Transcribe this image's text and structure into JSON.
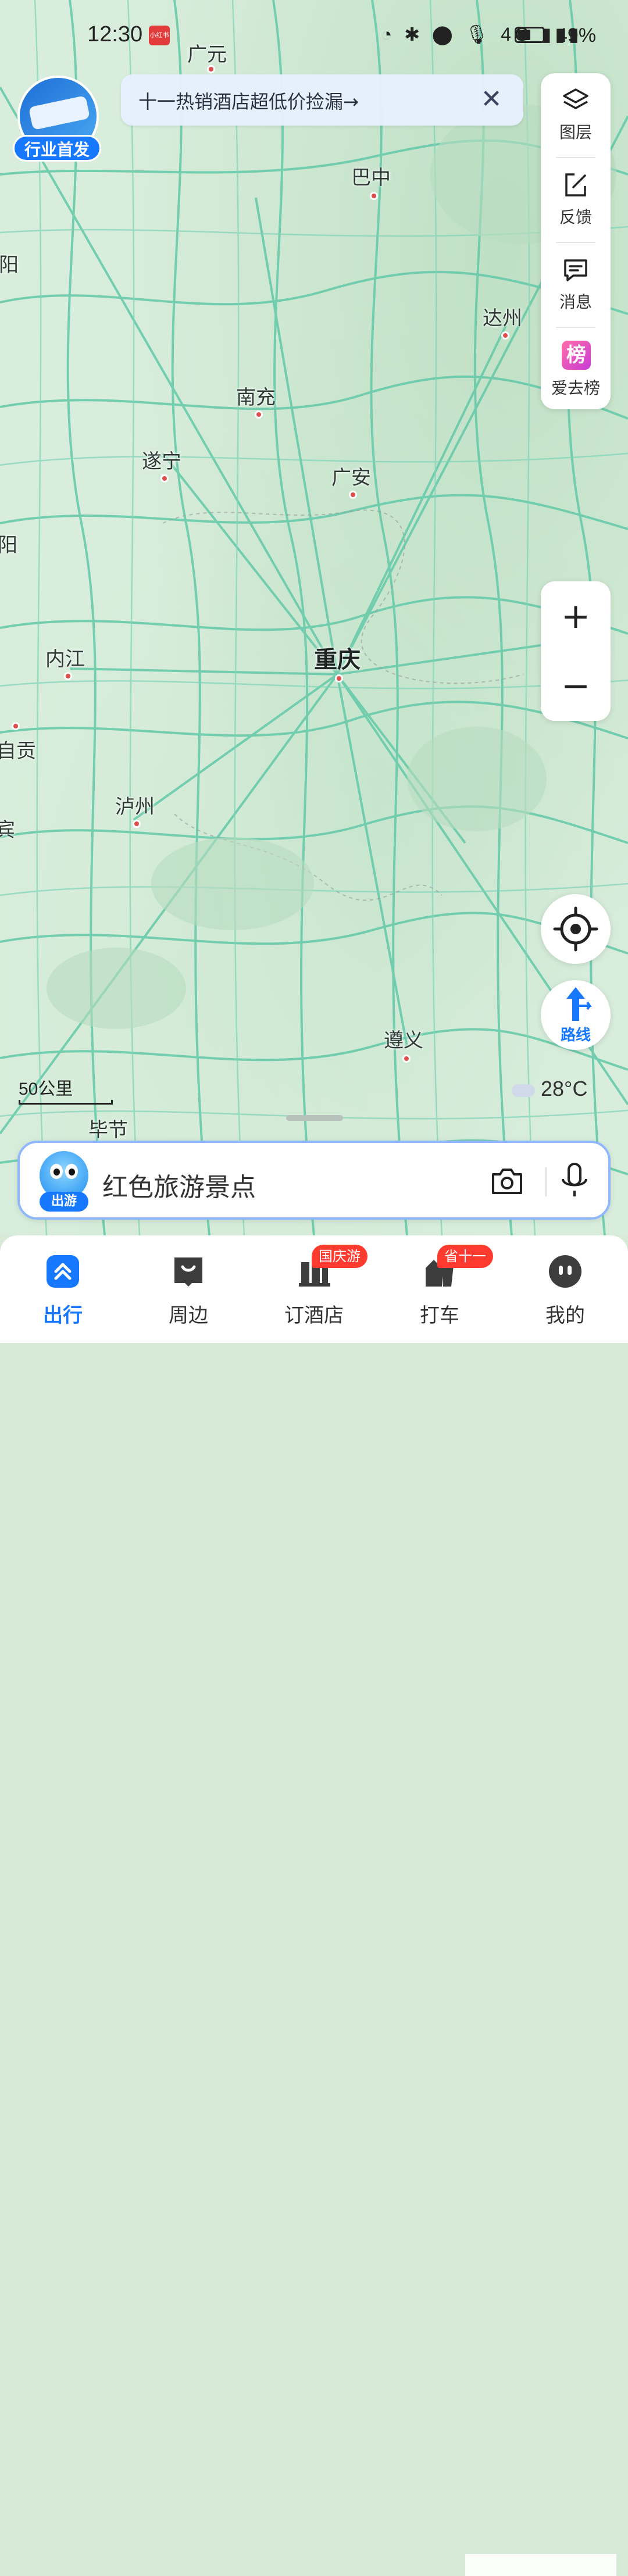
{
  "status_bar": {
    "time": "12:30",
    "app_badge": "小红书",
    "icons": "◔ ✱ ⬤ 🎙 4G ▮▮▮",
    "battery_percent": "49%"
  },
  "promo": {
    "tag": "行业首发"
  },
  "banner": {
    "text": "十一热销酒店超低价捡漏→",
    "close": "✕"
  },
  "tools": [
    {
      "label": "图层",
      "icon": "layers-icon"
    },
    {
      "label": "反馈",
      "icon": "feedback-icon"
    },
    {
      "label": "消息",
      "icon": "message-icon"
    },
    {
      "label": "爱去榜",
      "icon": "ranking-icon",
      "icon_text": "榜"
    }
  ],
  "zoom": {
    "in": "+",
    "out": "−"
  },
  "route": {
    "label": "路线"
  },
  "weather": {
    "temperature": "28°C"
  },
  "scale": {
    "label": "50公里"
  },
  "map": {
    "cities": [
      {
        "name": "广元",
        "major": false
      },
      {
        "name": "巴中",
        "major": false
      },
      {
        "name": "达州",
        "major": false
      },
      {
        "name": "南充",
        "major": false
      },
      {
        "name": "遂宁",
        "major": false
      },
      {
        "name": "广安",
        "major": false
      },
      {
        "name": "重庆",
        "major": true
      },
      {
        "name": "内江",
        "major": false
      },
      {
        "name": "自贡",
        "major": false
      },
      {
        "name": "泸州",
        "major": false
      },
      {
        "name": "遵义",
        "major": false
      },
      {
        "name": "毕节",
        "major": false
      },
      {
        "name": "阳",
        "major": false
      },
      {
        "name": "阳",
        "major": false
      },
      {
        "name": "宾",
        "major": false
      }
    ]
  },
  "search": {
    "placeholder": "红色旅游景点",
    "mascot_tag": "出游"
  },
  "nav": {
    "items": [
      {
        "label": "出行",
        "active": true
      },
      {
        "label": "周边",
        "active": false
      },
      {
        "label": "订酒店",
        "active": false,
        "badge": "国庆游"
      },
      {
        "label": "打车",
        "active": false,
        "badge": "省十一"
      },
      {
        "label": "我的",
        "active": false
      }
    ]
  },
  "colors": {
    "accent": "#1677ff",
    "road": "#5cc8a8",
    "city_dot": "#e04b4b",
    "badge": "#ff3b30"
  }
}
